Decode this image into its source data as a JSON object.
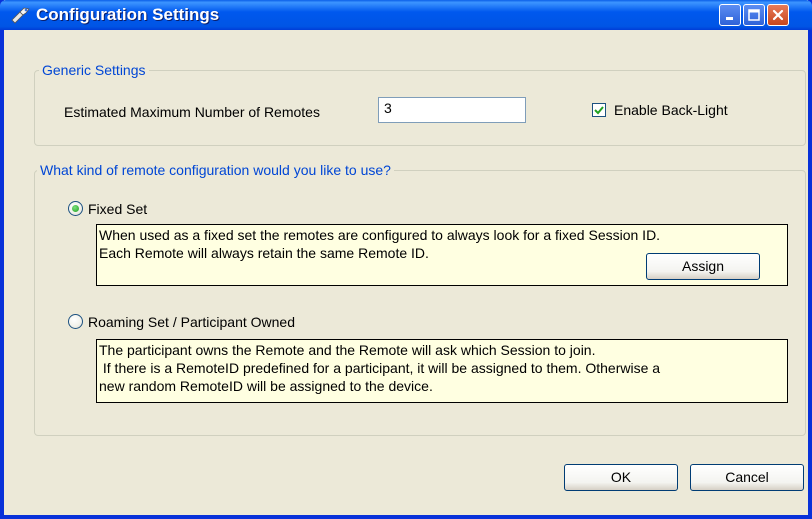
{
  "window": {
    "title": "Configuration Settings",
    "icon": "settings-icon"
  },
  "generic": {
    "legend": "Generic Settings",
    "max_remotes_label": "Estimated Maximum Number of Remotes",
    "max_remotes_value": "3",
    "backlight_label": "Enable Back-Light",
    "backlight_checked": true
  },
  "config": {
    "legend": "What kind of remote configuration would you like to use?",
    "fixed": {
      "label": "Fixed Set",
      "selected": true,
      "desc_line1": "When used as a fixed set the remotes are configured to always look for a fixed Session ID.",
      "desc_line2": "Each Remote will always retain the same Remote ID.",
      "assign_label": "Assign"
    },
    "roaming": {
      "label": "Roaming Set / Participant Owned",
      "selected": false,
      "desc_line1": "The participant owns the Remote and the Remote will ask which Session to join.",
      "desc_line2": " If there is a RemoteID predefined for a participant, it will be assigned to them. Otherwise a",
      "desc_line3": "new random RemoteID will be assigned to the device."
    }
  },
  "buttons": {
    "ok": "OK",
    "cancel": "Cancel"
  },
  "colors": {
    "titlebar": "#0058EE",
    "dialog_bg": "#ECE9D8",
    "legend_text": "#0046D5",
    "info_bg": "#FFFFE1",
    "close_button": "#C8461D"
  }
}
